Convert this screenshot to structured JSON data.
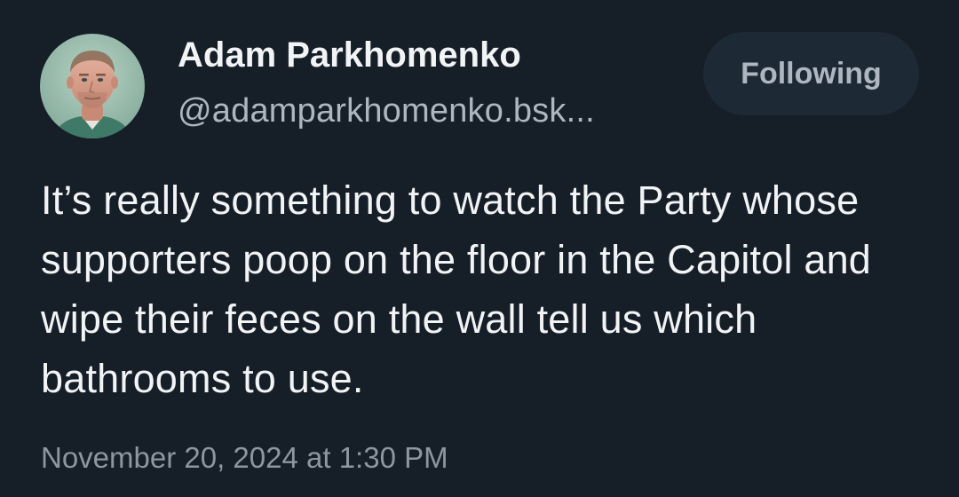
{
  "author": {
    "display_name": "Adam Parkhomenko",
    "handle": "@adamparkhomenko.bsk..."
  },
  "follow_button": {
    "label": "Following"
  },
  "post": {
    "text": "It’s really something to watch the Party whose supporters poop on the floor in the Capitol and wipe their feces on the wall tell us which bathrooms to use.",
    "timestamp": "November 20, 2024 at 1:30 PM"
  },
  "colors": {
    "background": "#161e27",
    "primary_text": "#f1f3f5",
    "secondary_text": "#aeb6c0",
    "timestamp_text": "#8d96a1",
    "button_background": "#1e2936"
  }
}
